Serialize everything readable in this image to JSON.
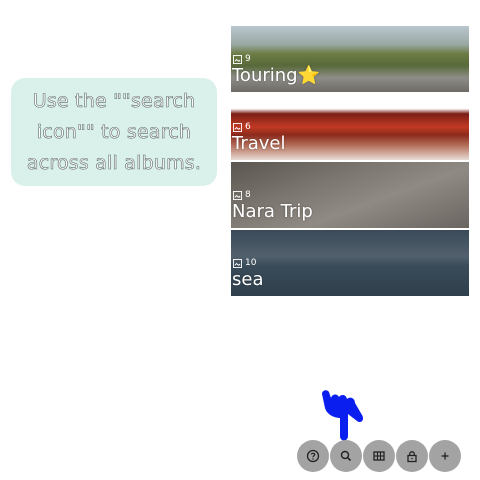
{
  "tooltip": {
    "text": "Use the \"\"search icon\"\" to search across all albums."
  },
  "albums": [
    {
      "count": "9",
      "title": "Touring⭐"
    },
    {
      "count": "6",
      "title": "Travel"
    },
    {
      "count": "8",
      "title": "Nara Trip"
    },
    {
      "count": "10",
      "title": "sea"
    }
  ],
  "toolbar": {
    "buttons": [
      "help-icon",
      "search-icon",
      "album-grid-icon",
      "lock-icon",
      "plus-icon"
    ]
  },
  "colors": {
    "tooltip_bg": "#d9f1ea",
    "toolbar_button": "#a3a3a3",
    "pointer_hand": "#0a1ef0"
  }
}
